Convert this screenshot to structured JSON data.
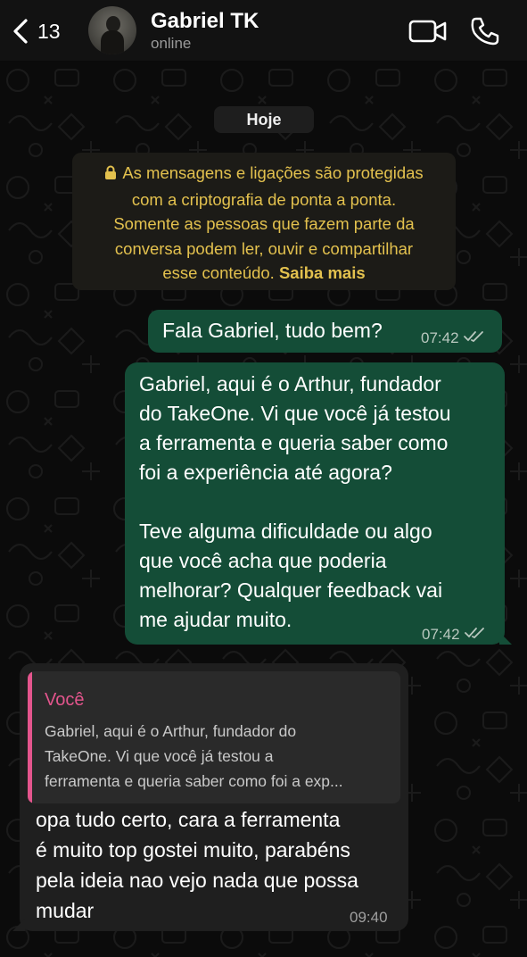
{
  "header": {
    "back_count": "13",
    "contact_name": "Gabriel TK",
    "status": "online",
    "icons": {
      "back": "chevron-left-icon",
      "video": "video-camera-icon",
      "call": "phone-icon"
    }
  },
  "chat": {
    "date_label": "Hoje",
    "encryption_notice": {
      "lines": [
        "As mensagens e ligações são protegidas",
        "com a criptografia de ponta a ponta.",
        "Somente as pessoas que fazem parte da",
        "conversa podem ler, ouvir e compartilhar",
        "esse conteúdo."
      ],
      "link": "Saiba mais"
    },
    "messages": [
      {
        "direction": "outgoing",
        "text": "Fala Gabriel, tudo bem?",
        "time": "07:42",
        "status": "read"
      },
      {
        "direction": "outgoing",
        "lines": [
          "Gabriel, aqui é o Arthur, fundador",
          "do TakeOne. Vi que você já testou",
          "a ferramenta e queria saber como",
          "foi a experiência até agora?",
          "Teve alguma dificuldade ou algo",
          "que você acha que poderia",
          "melhorar? Qualquer feedback vai",
          "me ajudar muito."
        ],
        "time": "07:42",
        "status": "read"
      },
      {
        "direction": "incoming",
        "quote": {
          "author": "Você",
          "lines": [
            "Gabriel, aqui é o Arthur, fundador do",
            "TakeOne. Vi que você já testou a",
            "ferramenta e queria saber como foi a exp..."
          ]
        },
        "lines": [
          "opa tudo certo, cara a ferramenta",
          "é muito top gostei muito, parabéns",
          "pela ideia nao vejo nada que possa",
          "mudar"
        ],
        "time": "09:40"
      }
    ]
  },
  "colors": {
    "background": "#0b0b0b",
    "outgoing_bubble": "#144d37",
    "incoming_bubble": "#1f1f1f",
    "notice_text": "#e3c14e",
    "quote_accent": "#e4558d"
  }
}
